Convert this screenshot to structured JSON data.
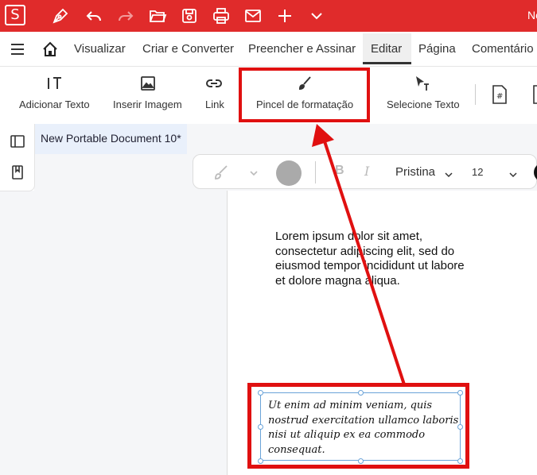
{
  "titlebar": {
    "logo_letter": "S",
    "app_title": "No",
    "icons": [
      "pen-icon",
      "undo-icon",
      "redo-icon",
      "open-folder-icon",
      "save-icon",
      "print-icon",
      "mail-icon",
      "plus-icon",
      "chevron-down-icon"
    ]
  },
  "menu": {
    "items": [
      "Visualizar",
      "Criar e Converter",
      "Preencher e Assinar",
      "Editar",
      "Página",
      "Comentário"
    ],
    "active": "Editar"
  },
  "ribbon": {
    "add_text": "Adicionar Texto",
    "insert_image": "Inserir Imagem",
    "link": "Link",
    "format_painter": "Pincel de formatação",
    "select_text": "Selecione Texto"
  },
  "document": {
    "tab_title": "New Portable Document 10*",
    "body_text": "Lorem ipsum dolor sit amet, consectetur adipiscing elit, sed do eiusmod tempor incididunt ut labore et dolore magna aliqua.",
    "textbox_text": "Ut enim ad minim veniam, quis nostrud exercitation ullamco laboris nisi ut aliquip ex ea commodo consequat."
  },
  "format_bar": {
    "bold": "B",
    "italic": "I",
    "font_name": "Pristina",
    "font_size": "12"
  },
  "colors": {
    "titlebar": "#e02b2b",
    "highlight": "#e01010",
    "selection": "#6aa3d8"
  }
}
